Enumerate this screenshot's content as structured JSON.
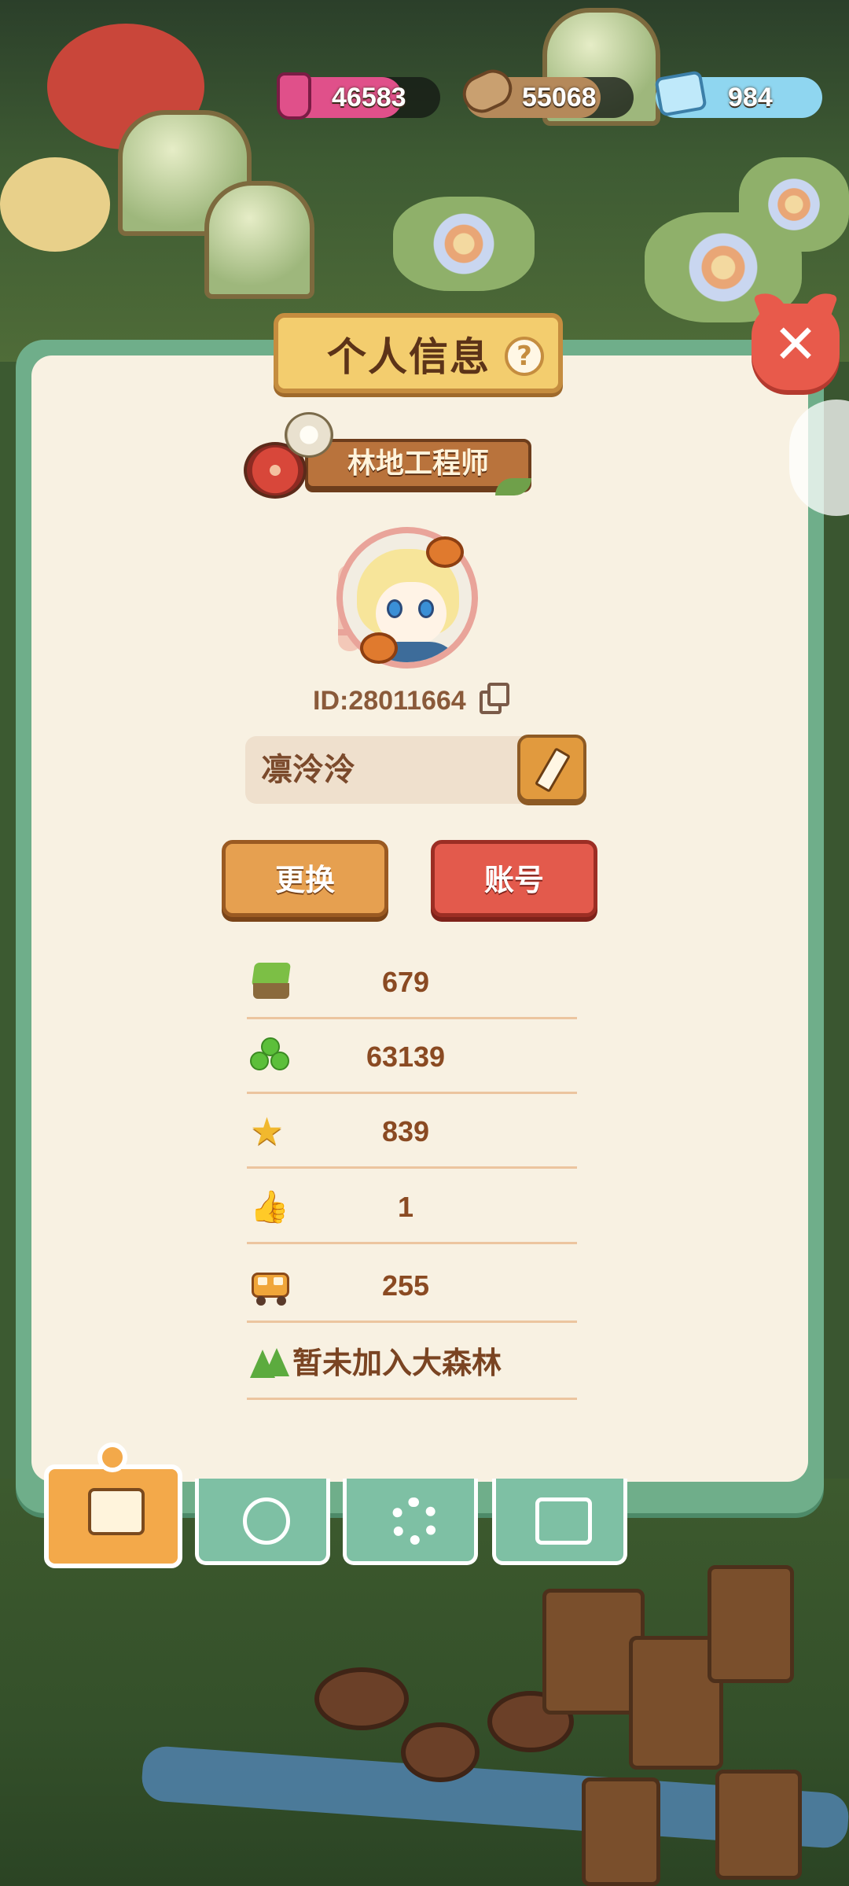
{
  "resources": [
    {
      "name": "ink",
      "icon": "ink-bottle-icon",
      "value": "46583",
      "color": "#e0508a"
    },
    {
      "name": "wood",
      "icon": "wood-log-icon",
      "value": "55068",
      "color": "#b5895a"
    },
    {
      "name": "diamond",
      "icon": "diamond-plus-icon",
      "value": "984",
      "color": "#8fd6f0"
    }
  ],
  "panel": {
    "title": "个人信息",
    "help_symbol": "?",
    "close_symbol": "✕"
  },
  "profile": {
    "rank_title": "林地工程师",
    "id_text": "ID:28011664",
    "name": "凛泠泠"
  },
  "buttons": {
    "change_label": "更换",
    "account_label": "账号"
  },
  "stats": [
    {
      "icon": "grass-block-icon",
      "value": "679"
    },
    {
      "icon": "clover-icon",
      "value": "63139"
    },
    {
      "icon": "star-icon",
      "value": "839"
    },
    {
      "icon": "thumbs-up-icon",
      "value": "1"
    },
    {
      "icon": "bus-icon",
      "value": "255"
    }
  ],
  "forest": {
    "icon": "tree-icon",
    "text": "暂未加入大森林"
  },
  "tabs": [
    {
      "icon": "profile-card-icon",
      "active": true
    },
    {
      "icon": "badge-icon",
      "active": false
    },
    {
      "icon": "gear-icon",
      "active": false
    },
    {
      "icon": "photo-album-icon",
      "active": false
    }
  ],
  "colors": {
    "panel_border": "#6fae8a",
    "panel_bg": "#f8f1e2",
    "title_plate": "#f3cd6e",
    "close_button": "#e85a4b",
    "change_button": "#e6a050",
    "account_button": "#e35a4c"
  }
}
